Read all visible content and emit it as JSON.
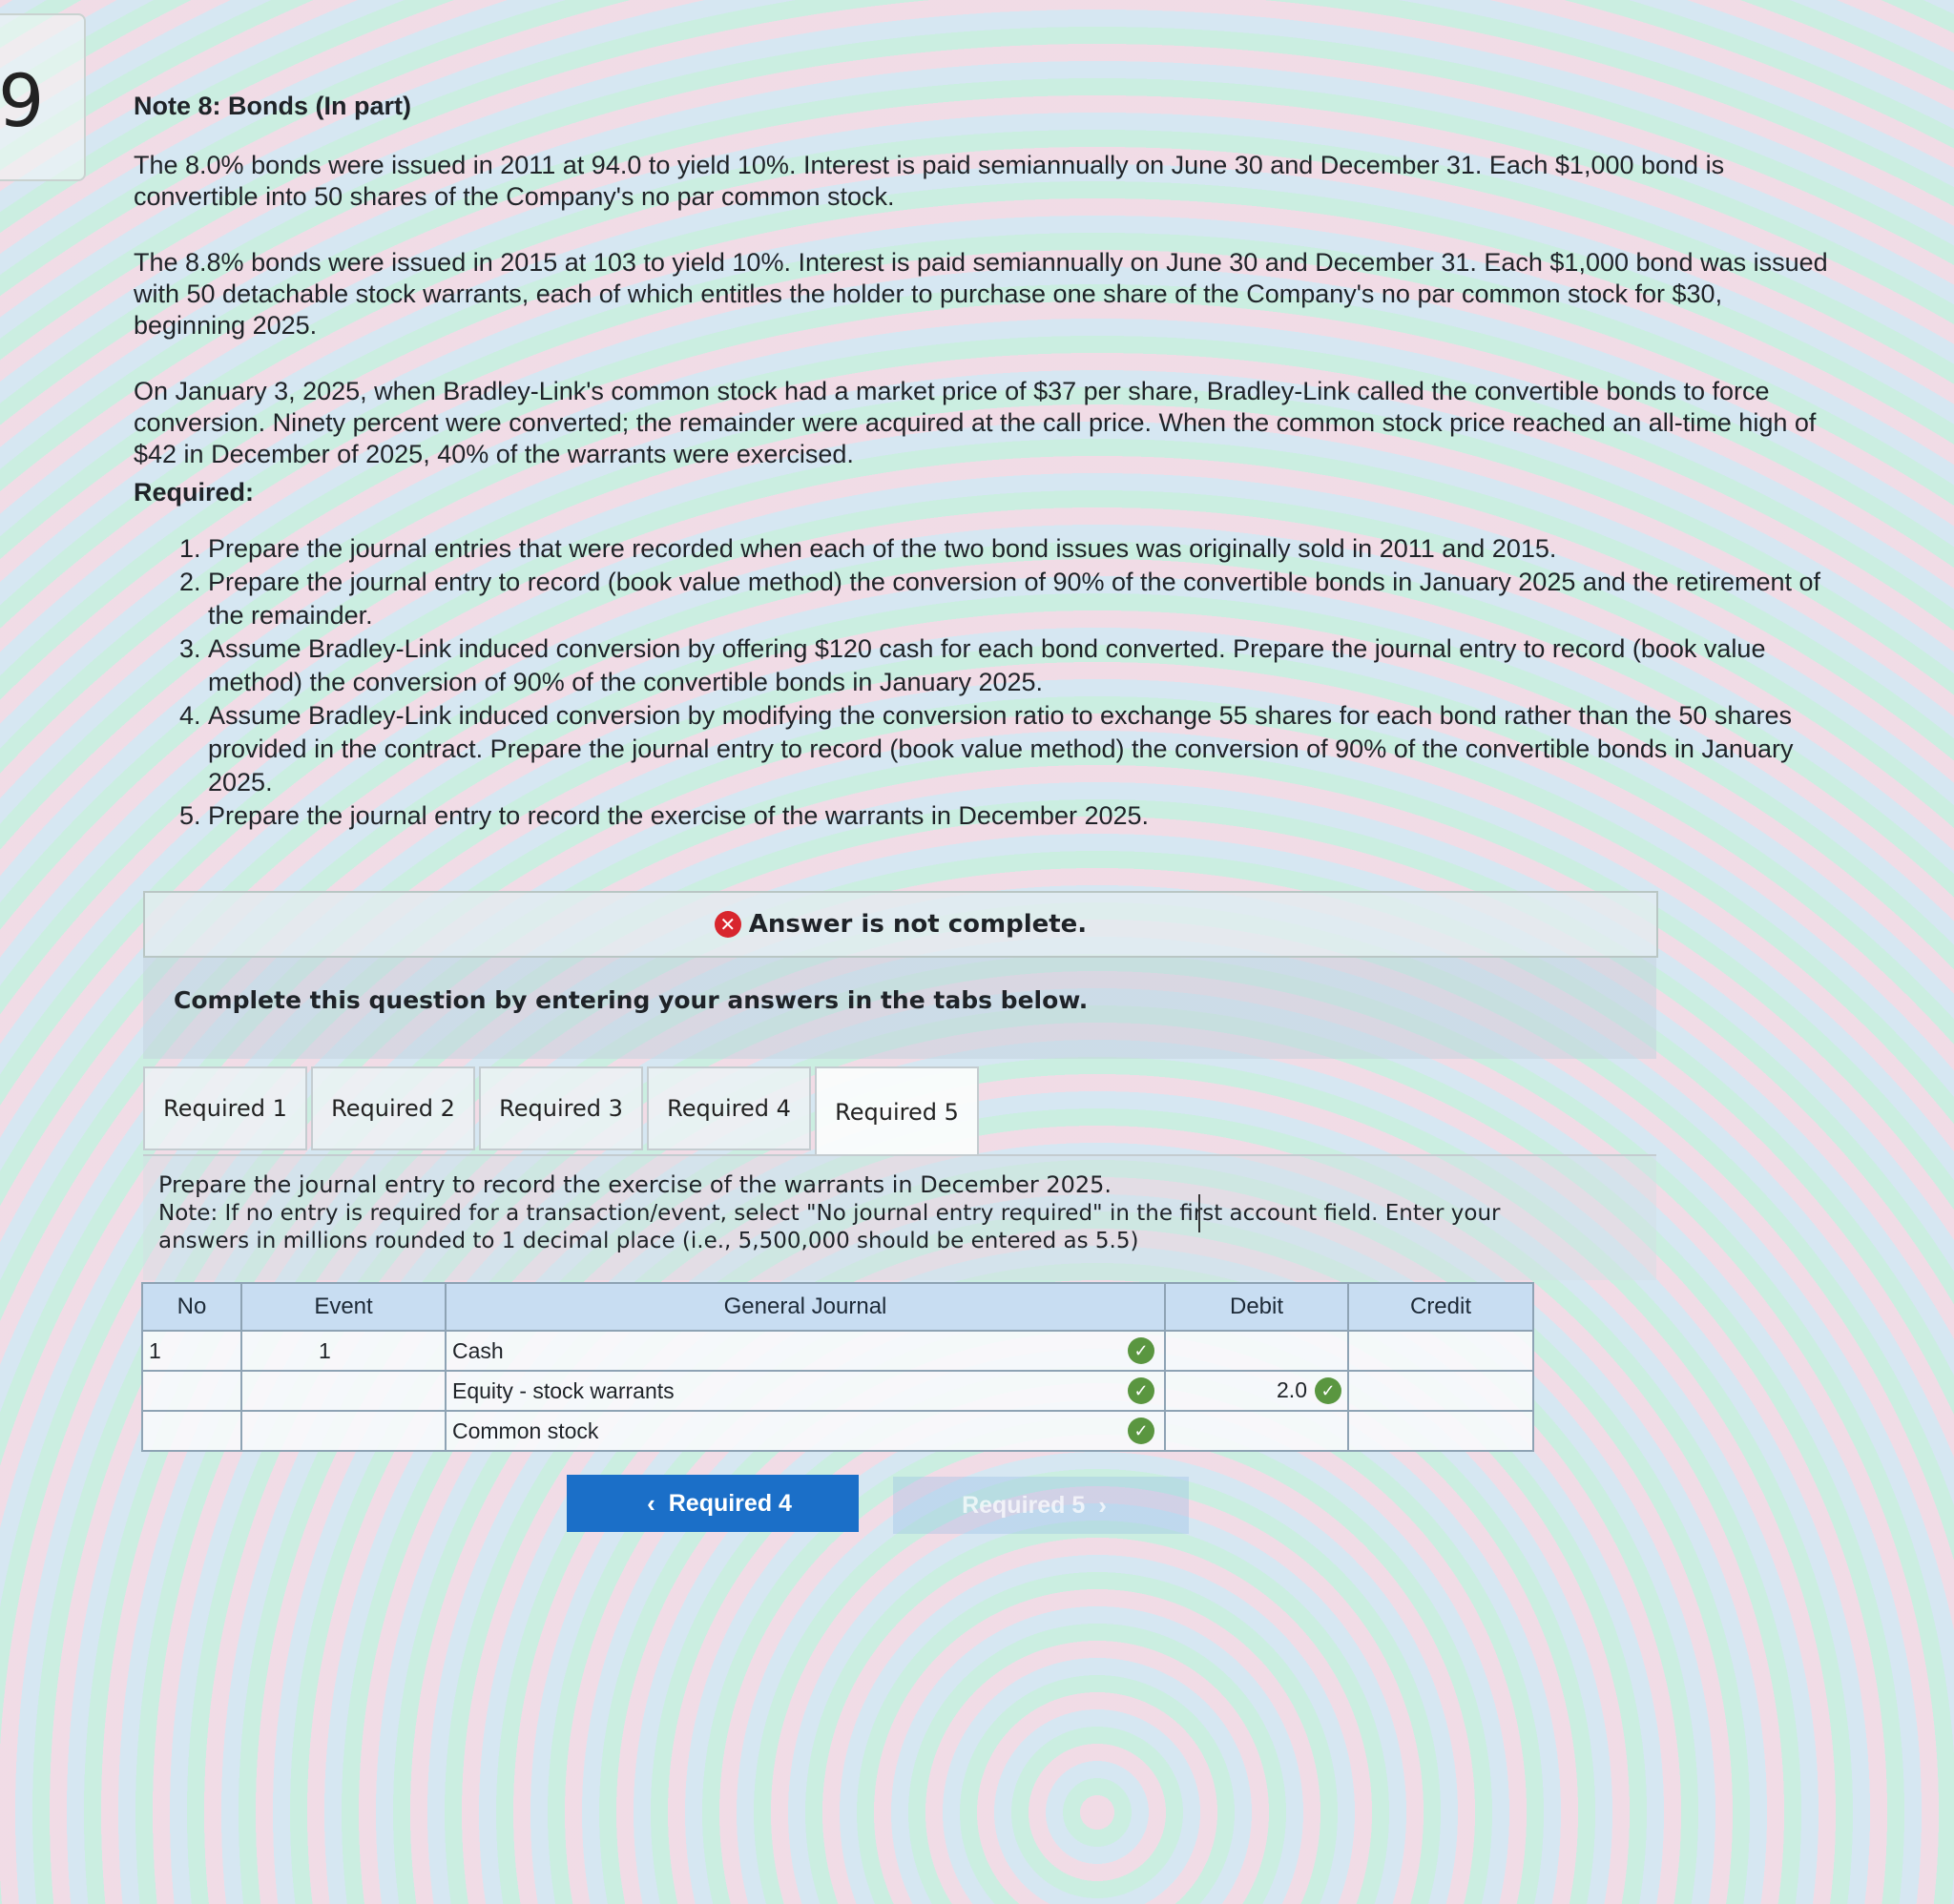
{
  "question_number": "9",
  "note_title": "Note 8: Bonds (In part)",
  "paragraphs": [
    "The 8.0% bonds were issued in 2011 at 94.0 to yield 10%. Interest is paid semiannually on June 30 and December 31. Each $1,000 bond is convertible into 50 shares of the Company's no par common stock.",
    "The 8.8% bonds were issued in 2015 at 103 to yield 10%. Interest is paid semiannually on June 30 and December 31. Each $1,000 bond was issued with 50 detachable stock warrants, each of which entitles the holder to purchase one share of the Company's no par common stock for $30, beginning 2025.",
    "On January 3, 2025, when Bradley-Link's common stock had a market price of $37 per share, Bradley-Link called the convertible bonds to force conversion. Ninety percent were converted; the remainder were acquired at the call price. When the common stock price reached an all-time high of $42 in December of 2025, 40% of the warrants were exercised."
  ],
  "required_label": "Required:",
  "requirements": [
    "Prepare the journal entries that were recorded when each of the two bond issues was originally sold in 2011 and 2015.",
    "Prepare the journal entry to record (book value method) the conversion of 90% of the convertible bonds in January 2025 and the retirement of the remainder.",
    "Assume Bradley-Link induced conversion by offering $120 cash for each bond converted. Prepare the journal entry to record (book value method) the conversion of 90% of the convertible bonds in January 2025.",
    "Assume Bradley-Link induced conversion by modifying the conversion ratio to exchange 55 shares for each bond rather than the 50 shares provided in the contract. Prepare the journal entry to record (book value method) the conversion of 90% of the convertible bonds in January 2025.",
    "Prepare the journal entry to record the exercise of the warrants in December 2025."
  ],
  "status": {
    "text": "Answer is not complete.",
    "icon": "x-circle-icon",
    "color": "#d8262e"
  },
  "instruction": "Complete this question by entering your answers in the tabs below.",
  "tabs": [
    "Required 1",
    "Required 2",
    "Required 3",
    "Required 4",
    "Required 5"
  ],
  "active_tab": 4,
  "tab_prompt": "Prepare the journal entry to record the exercise of the warrants in December 2025.",
  "tab_note": "Note: If no entry is required for a transaction/event, select \"No journal entry required\" in the first account field. Enter your answers in millions rounded to 1 decimal place (i.e., 5,500,000 should be entered as 5.5)",
  "journal": {
    "headers": [
      "No",
      "Event",
      "General Journal",
      "Debit",
      "Credit"
    ],
    "rows": [
      {
        "no": "1",
        "event": "1",
        "account": "Cash",
        "debit": "",
        "credit": ""
      },
      {
        "no": "",
        "event": "",
        "account": "Equity - stock warrants",
        "debit": "2.0",
        "credit": ""
      },
      {
        "no": "",
        "event": "",
        "account": "Common stock",
        "debit": "",
        "credit": ""
      }
    ]
  },
  "nav": {
    "prev_label": "Required 4",
    "next_label": "Required 5"
  },
  "colors": {
    "header_bg": "#c8ddf2",
    "check": "#5a9640",
    "nav_button": "#1b6fc8"
  }
}
